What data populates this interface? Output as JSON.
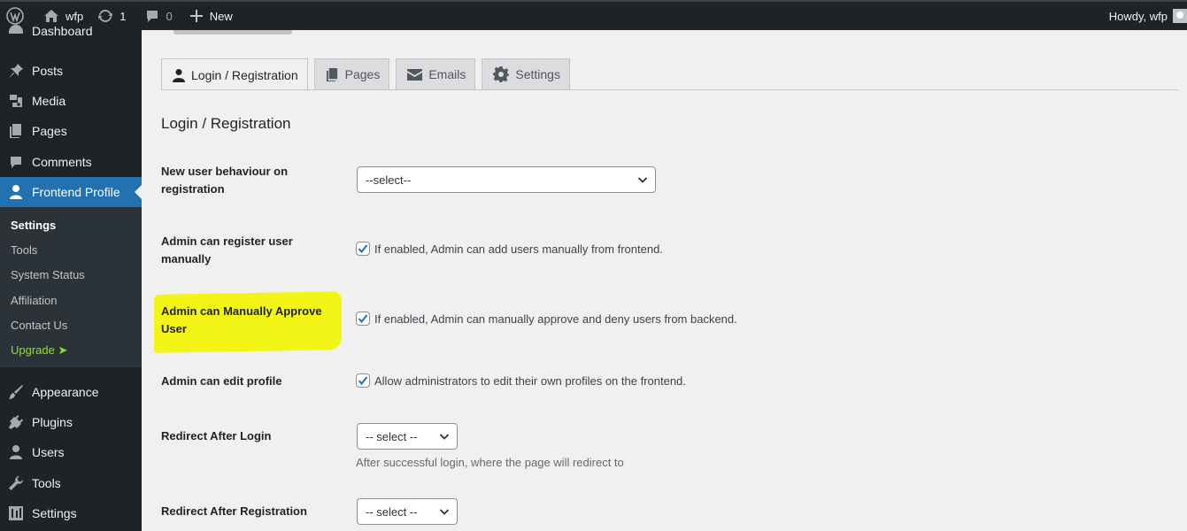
{
  "admin_bar": {
    "site_name": "wfp",
    "updates_count": "1",
    "comments_count": "0",
    "new_label": "New",
    "howdy": "Howdy, wfp"
  },
  "sidebar": {
    "items": [
      {
        "label": "Dashboard",
        "icon": "dashboard-icon"
      },
      {
        "label": "Posts",
        "icon": "pin-icon"
      },
      {
        "label": "Media",
        "icon": "media-icon"
      },
      {
        "label": "Pages",
        "icon": "pages-icon"
      },
      {
        "label": "Comments",
        "icon": "comment-icon"
      },
      {
        "label": "Frontend Profile",
        "icon": "user-icon"
      },
      {
        "label": "Appearance",
        "icon": "brush-icon"
      },
      {
        "label": "Plugins",
        "icon": "plugin-icon"
      },
      {
        "label": "Users",
        "icon": "users-icon"
      },
      {
        "label": "Tools",
        "icon": "wrench-icon"
      },
      {
        "label": "Settings",
        "icon": "settings-icon"
      }
    ],
    "submenu": [
      "Settings",
      "Tools",
      "System Status",
      "Affiliation",
      "Contact Us",
      "Upgrade ➤"
    ]
  },
  "tabs": [
    {
      "label": "Login / Registration",
      "icon": "user-icon"
    },
    {
      "label": "Pages",
      "icon": "pages-icon"
    },
    {
      "label": "Emails",
      "icon": "email-icon"
    },
    {
      "label": "Settings",
      "icon": "gear-icon"
    }
  ],
  "section_title": "Login / Registration",
  "fields": {
    "new_user_behaviour": {
      "label": "New user behaviour on registration",
      "value": "--select--"
    },
    "admin_register": {
      "label": "Admin can register user manually",
      "checkbox_text": "If enabled, Admin can add users manually from frontend."
    },
    "admin_approve": {
      "label": "Admin can Manually Approve User",
      "checkbox_text": "If enabled, Admin can manually approve and deny users from backend."
    },
    "admin_edit": {
      "label": "Admin can edit profile",
      "checkbox_text": "Allow administrators to edit their own profiles on the frontend."
    },
    "redirect_login": {
      "label": "Redirect After Login",
      "value": "-- select --",
      "description": "After successful login, where the page will redirect to"
    },
    "redirect_registration": {
      "label": "Redirect After Registration",
      "value": "-- select --"
    }
  },
  "colors": {
    "accent": "#2271b1",
    "highlight": "#f2f515",
    "upgrade": "#8ee01f"
  }
}
